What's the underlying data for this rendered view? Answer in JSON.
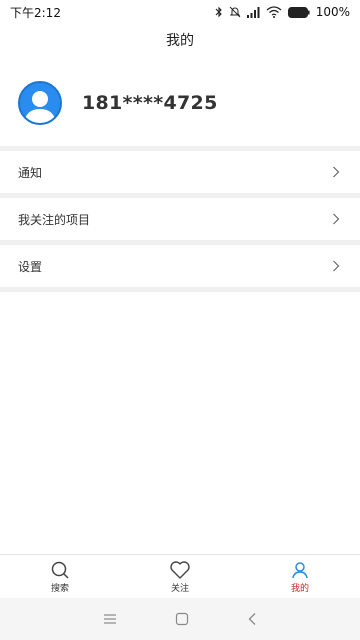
{
  "status_bar": {
    "time": "下午2:12",
    "battery": "100%",
    "icons": [
      "bluetooth-icon",
      "mute-icon",
      "signal-icon",
      "wifi-icon",
      "battery-icon"
    ]
  },
  "header": {
    "title": "我的"
  },
  "profile": {
    "phone": "181****4725",
    "avatar_icon": "avatar-user-icon"
  },
  "menu": {
    "items": [
      {
        "label": "通知"
      },
      {
        "label": "我关注的项目"
      },
      {
        "label": "设置"
      }
    ]
  },
  "bottom_nav": {
    "items": [
      {
        "label": "搜索",
        "icon": "search-icon"
      },
      {
        "label": "关注",
        "icon": "heart-icon"
      },
      {
        "label": "我的",
        "icon": "user-icon",
        "active": true
      }
    ]
  },
  "system_nav": {
    "icons": [
      "menu-icon",
      "home-icon",
      "back-icon"
    ]
  },
  "colors": {
    "avatar": "#2b8cf0",
    "active_tab": "#c62828",
    "active_icon": "#2b8cf0",
    "divider": "#f0f0f0"
  }
}
